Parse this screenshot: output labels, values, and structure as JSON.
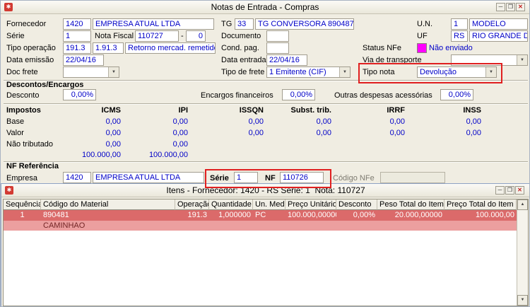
{
  "icons": {
    "app": "✱",
    "minimize": "─",
    "maximize": "❒",
    "close": "✕",
    "dropdown": "▼",
    "scroll_up": "▲",
    "scroll_down": "▼"
  },
  "main_window": {
    "title": "Notas de Entrada - Compras"
  },
  "form": {
    "fornecedor": {
      "label": "Fornecedor",
      "code": "1420",
      "name": "EMPRESA ATUAL LTDA"
    },
    "tg": {
      "label": "TG",
      "code": "33",
      "name": "TG CONVERSORA 890487"
    },
    "un": {
      "label": "U.N.",
      "code": "1",
      "name": "MODELO"
    },
    "serie": {
      "label": "Série",
      "value": "1"
    },
    "nota_fiscal": {
      "label": "Nota Fiscal",
      "value": "110727",
      "sep": "-",
      "suffix": "0"
    },
    "documento": {
      "label": "Documento",
      "value": ""
    },
    "uf": {
      "label": "UF",
      "code": "RS",
      "name": "RIO GRANDE DO SUL"
    },
    "tipo_operacao": {
      "label": "Tipo operação",
      "code": "191.3",
      "code2": "1.91.3",
      "desc": "Retorno mercad. remetido demonstra"
    },
    "cond_pag": {
      "label": "Cond. pag.",
      "value": ""
    },
    "status_nfe": {
      "label": "Status NFe",
      "value": "Não enviado",
      "color": "#ff00ff"
    },
    "data_emissao": {
      "label": "Data emissão",
      "value": "22/04/16"
    },
    "data_entrada": {
      "label": "Data entrada",
      "value": "22/04/16"
    },
    "via_transporte": {
      "label": "Via de transporte",
      "value": ""
    },
    "doc_frete": {
      "label": "Doc frete",
      "value": ""
    },
    "tipo_frete": {
      "label": "Tipo de frete",
      "value": "1 Emitente (CIF)"
    },
    "tipo_nota": {
      "label": "Tipo nota",
      "value": "Devolução"
    }
  },
  "descontos": {
    "section_title": "Descontos/Encargos",
    "desconto": {
      "label": "Desconto",
      "value": "0,00%"
    },
    "encargos": {
      "label": "Encargos financeiros",
      "value": "0,00%"
    },
    "outras": {
      "label": "Outras despesas acessórias",
      "value": "0,00%"
    }
  },
  "impostos": {
    "section_title": "Impostos",
    "columns": [
      "ICMS",
      "IPI",
      "ISSQN",
      "Subst. trib.",
      "IRRF",
      "INSS"
    ],
    "rows": [
      {
        "label": "Base",
        "values": [
          "0,00",
          "0,00",
          "0,00",
          "0,00",
          "0,00",
          "0,00"
        ]
      },
      {
        "label": "Valor",
        "values": [
          "0,00",
          "0,00",
          "0,00",
          "0,00",
          "0,00",
          "0,00"
        ]
      },
      {
        "label": "Não tributado",
        "values": [
          "0,00",
          "0,00",
          "",
          "",
          "",
          ""
        ]
      },
      {
        "label": "",
        "values": [
          "100.000,00",
          "100.000,00",
          "",
          "",
          "",
          ""
        ]
      }
    ]
  },
  "nf_referencia": {
    "section_title": "NF Referência",
    "empresa": {
      "label": "Empresa",
      "code": "1420",
      "name": "EMPRESA ATUAL LTDA"
    },
    "serie": {
      "label": "Série",
      "value": "1"
    },
    "nf": {
      "label": "NF",
      "value": "110726"
    },
    "codigo_nfe": {
      "label": "Código NFe",
      "value": ""
    }
  },
  "itens": {
    "title": "Itens - Fornecedor: 1420 - RS Série: 1  Nota: 110727",
    "columns": [
      "Sequência",
      "Código do Material",
      "Operação",
      "Quantidade",
      "Un. Med.",
      "Preço Unitário",
      "Desconto",
      "Peso Total do Item",
      "Preço Total do Item"
    ],
    "rows": [
      {
        "seq": "1",
        "codigo": "890481",
        "descricao": "CAMINHAO",
        "operacao": "191.3",
        "quantidade": "1,000000",
        "un": "PC",
        "preco_unitario": "100.000,00000",
        "desconto": "0,00%",
        "peso_total": "20.000,00000",
        "preco_total": "100.000,00"
      }
    ]
  }
}
